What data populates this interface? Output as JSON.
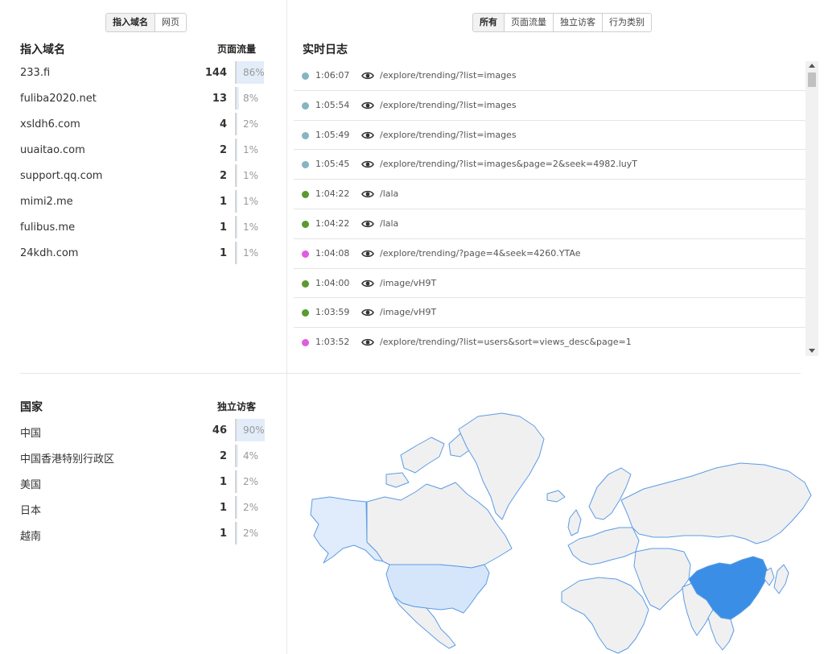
{
  "colors": {
    "accent_blue": "#4a90e2",
    "bar_light": "#e3edf9",
    "map_land": "#f0f0f0",
    "map_stroke": "#5b9be6",
    "map_china": "#3a8ee6",
    "map_usa": "#d6e6fa",
    "map_alaska": "#e0ecfb"
  },
  "referrers": {
    "tabs": [
      {
        "label": "指入域名",
        "active": true
      },
      {
        "label": "网页",
        "active": false
      }
    ],
    "title": "指入域名",
    "metric_label": "页面流量",
    "rows": [
      {
        "name": "233.fi",
        "count": "144",
        "pct": "86%",
        "share": 0.86
      },
      {
        "name": "fuliba2020.net",
        "count": "13",
        "pct": "8%",
        "share": 0.08
      },
      {
        "name": "xsldh6.com",
        "count": "4",
        "pct": "2%",
        "share": 0.02
      },
      {
        "name": "uuaitao.com",
        "count": "2",
        "pct": "1%",
        "share": 0.01
      },
      {
        "name": "support.qq.com",
        "count": "2",
        "pct": "1%",
        "share": 0.01
      },
      {
        "name": "mimi2.me",
        "count": "1",
        "pct": "1%",
        "share": 0.01
      },
      {
        "name": "fulibus.me",
        "count": "1",
        "pct": "1%",
        "share": 0.01
      },
      {
        "name": "24kdh.com",
        "count": "1",
        "pct": "1%",
        "share": 0.01
      }
    ]
  },
  "realtime": {
    "tabs": [
      {
        "label": "所有",
        "active": true
      },
      {
        "label": "页面流量",
        "active": false
      },
      {
        "label": "独立访客",
        "active": false
      },
      {
        "label": "行为类别",
        "active": false
      }
    ],
    "title": "实时日志",
    "icon": "eye-icon",
    "entries": [
      {
        "time": "1:06:07",
        "path": "/explore/trending/?list=images",
        "color": "#86b5c4"
      },
      {
        "time": "1:05:54",
        "path": "/explore/trending/?list=images",
        "color": "#86b5c4"
      },
      {
        "time": "1:05:49",
        "path": "/explore/trending/?list=images",
        "color": "#86b5c4"
      },
      {
        "time": "1:05:45",
        "path": "/explore/trending/?list=images&page=2&seek=4982.luyT",
        "color": "#86b5c4"
      },
      {
        "time": "1:04:22",
        "path": "/lala",
        "color": "#5a9a2e"
      },
      {
        "time": "1:04:22",
        "path": "/lala",
        "color": "#5a9a2e"
      },
      {
        "time": "1:04:08",
        "path": "/explore/trending/?page=4&seek=4260.YTAe",
        "color": "#e05ce0"
      },
      {
        "time": "1:04:00",
        "path": "/image/vH9T",
        "color": "#5a9a2e"
      },
      {
        "time": "1:03:59",
        "path": "/image/vH9T",
        "color": "#5a9a2e"
      },
      {
        "time": "1:03:52",
        "path": "/explore/trending/?list=users&sort=views_desc&page=1",
        "color": "#e05ce0"
      }
    ]
  },
  "countries": {
    "title": "国家",
    "metric_label": "独立访客",
    "rows": [
      {
        "name": "中国",
        "count": "46",
        "pct": "90%",
        "share": 0.9
      },
      {
        "name": "中国香港特别行政区",
        "count": "2",
        "pct": "4%",
        "share": 0.04
      },
      {
        "name": "美国",
        "count": "1",
        "pct": "2%",
        "share": 0.02
      },
      {
        "name": "日本",
        "count": "1",
        "pct": "2%",
        "share": 0.02
      },
      {
        "name": "越南",
        "count": "1",
        "pct": "2%",
        "share": 0.02
      }
    ]
  }
}
